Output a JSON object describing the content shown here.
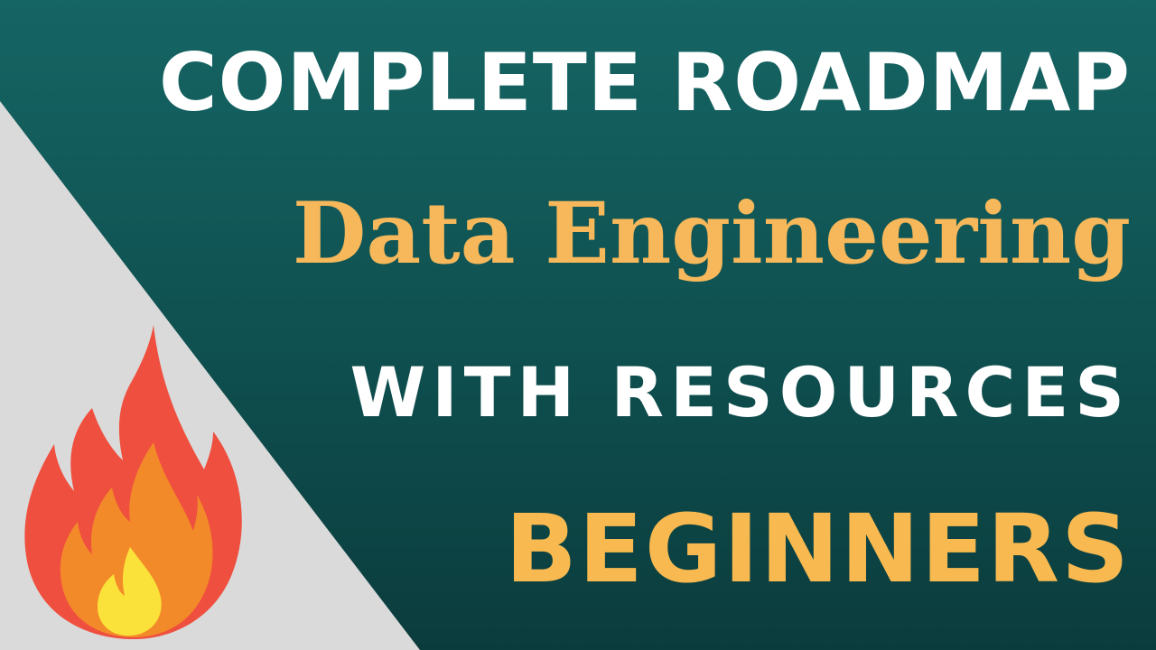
{
  "thumbnail": {
    "headline": "COMPLETE ROADMAP",
    "topic": "Data Engineering",
    "subheadline": "WITH RESOURCES",
    "audience": "BEGINNERS"
  },
  "colors": {
    "background_top": "#156564",
    "background_bottom": "#0b3c3d",
    "corner_panel": "#dadada",
    "headline_text": "#ffffff",
    "accent_text": "#f6b85a",
    "flame_outer": "#ef4f3e",
    "flame_middle": "#f38a2a",
    "flame_inner": "#fbe23a"
  },
  "icons": {
    "decoration": "fire-icon"
  }
}
